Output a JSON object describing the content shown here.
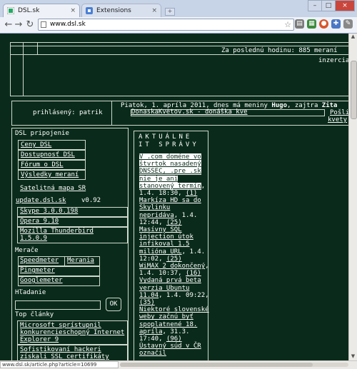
{
  "browser": {
    "tabs": [
      {
        "title": "DSL.sk",
        "active": true
      },
      {
        "title": "Extensions",
        "active": false
      }
    ],
    "address": "www.dsl.sk",
    "status_url": "www.dsl.sk/article.php?article=10699"
  },
  "header": {
    "last_hour_label": "Za poslednú hodinu: 885 meraní",
    "inzercia": "inzercia"
  },
  "userbar": {
    "logged_in": "prihlásený: patrik",
    "date_text": "Piatok, 1. apríla 2011, dnes má meniny ",
    "name_day": "Hugo",
    "tomorrow_text": ", zajtra ",
    "tomorrow_name": "Zita",
    "ticker": "DonaskaKvetov.sk - donáška kve",
    "side_link1": "Pošli",
    "side_link2": "kvety"
  },
  "sidebar": {
    "dsl_heading": "DSL pripojenie",
    "dsl_items": [
      "Ceny DSL",
      "Dostupnosť DSL",
      "Fórum o DSL",
      "Výsledky meraní"
    ],
    "satellite": "Satelitná mapa SR",
    "update_link": "update.dsl.sk",
    "update_version": "v0.92",
    "software": [
      "Skype 3.0.0.198",
      "Opera 9.10",
      "Mozilla Thunderbird 1.5.0.9"
    ],
    "meters_heading": "Merače",
    "meters": [
      "Speedmeter",
      "Merania",
      "Pingmeter",
      "Googlemeter"
    ],
    "search_heading": "Hľadanie",
    "search_button": "OK",
    "top_heading": "Top články",
    "top_items": [
      "Microsoft sprístupnil konkurencieschopný Internet Explorer 9",
      "Sofistikovaní hackeri získali SSL certifikáty"
    ]
  },
  "news": {
    "title": "AKTUÁLNE IT SPRÁVY",
    "items": [
      {
        "headline": "V .com doméne vo štvrtok nasadený DNSSEC, .pre .sk nie je ani stanovený termín",
        "date": ", 1.4. 18:30, ",
        "count": "(1)"
      },
      {
        "headline": "Markíza HD sa do Skylinku nepridáva",
        "date": ", 1.4. 12:44, ",
        "count": "(25)"
      },
      {
        "headline": "Masívny SQL injection útok infikoval 1.5 milióna URL",
        "date": ", 1.4. 12:02, ",
        "count": "(25)"
      },
      {
        "headline": "WiMAX 2 dokončený",
        "date": ", 1.4. 10:37, ",
        "count": "(16)"
      },
      {
        "headline": "Vydaná prvá beta verzia Ubuntu 11.04",
        "date": ", 1.4. 09:22, ",
        "count": "(35)"
      },
      {
        "headline": "Niektoré slovenské weby začnú byť spoplatnené 18. apríla",
        "date": ", 31.3. 17:40, ",
        "count": "(96)"
      },
      {
        "headline": "Ústavný súd v ČR označil",
        "date": "",
        "count": ""
      }
    ]
  },
  "colors": {
    "page_bg": "#0a2b1b",
    "text": "#ffffff",
    "lines": "#cfd8cc"
  }
}
